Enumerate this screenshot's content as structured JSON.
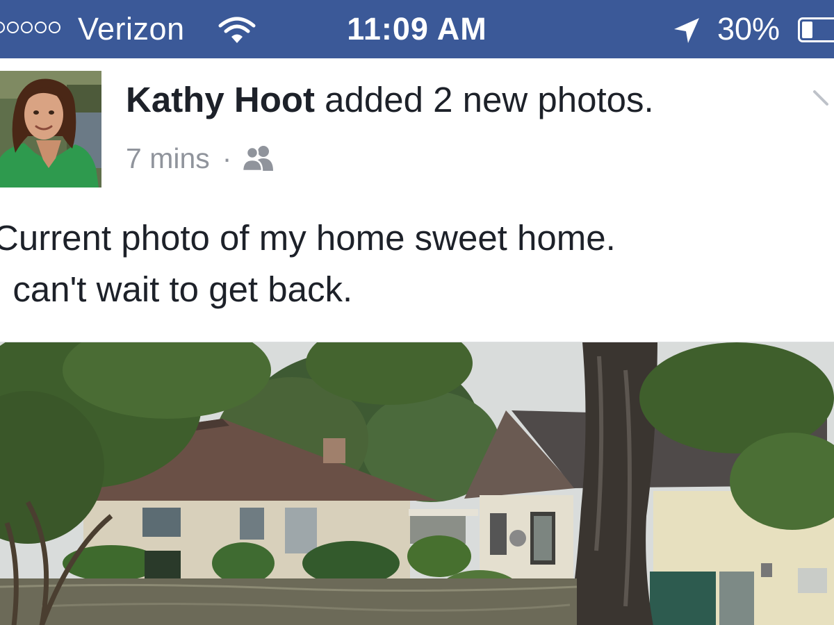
{
  "status_bar": {
    "carrier": "Verizon",
    "time": "11:09 AM",
    "battery_percent": "30%",
    "battery_level": 0.3,
    "signal_bars_filled": 0,
    "signal_bars_total": 5,
    "background_color": "#3b5998"
  },
  "post": {
    "author": "Kathy Hoot",
    "action": " added 2 new photos.",
    "time_ago": "7 mins",
    "separator": "·",
    "audience_icon": "friends-icon",
    "text_lines": [
      "Current photo of my home sweet home.",
      "I can't wait to get back."
    ]
  },
  "icons": {
    "wifi": "wifi-icon",
    "location": "location-arrow-icon",
    "battery": "battery-icon",
    "menu": "chevron-down-icon"
  },
  "colors": {
    "text_primary": "#1d2129",
    "text_secondary": "#90949c",
    "brand": "#3b5998"
  }
}
